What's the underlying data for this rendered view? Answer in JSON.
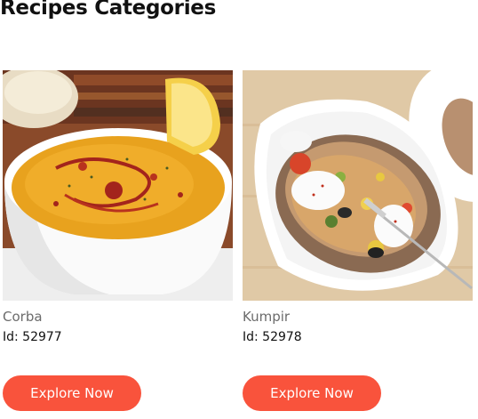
{
  "page": {
    "title": "Recipes Categories"
  },
  "theme": {
    "accent": "#f9533c",
    "title_color": "#111111",
    "name_color": "#6b6b6b"
  },
  "recipes": [
    {
      "name": "Corba",
      "id_text": "Id: 52977",
      "image_icon": "soup-photo",
      "button_label": "Explore Now"
    },
    {
      "name": "Kumpir",
      "id_text": "Id: 52978",
      "image_icon": "stuffed-potato-photo",
      "button_label": "Explore Now"
    }
  ]
}
